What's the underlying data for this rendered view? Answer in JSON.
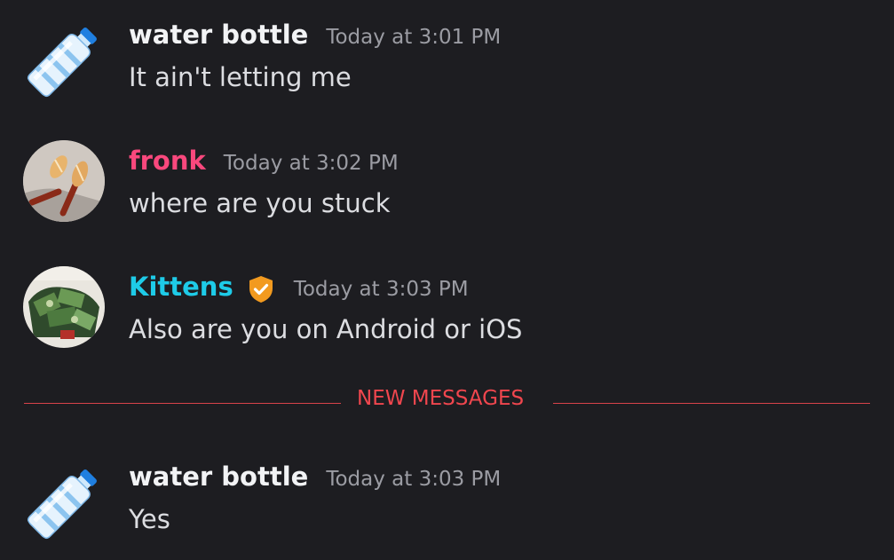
{
  "messages": [
    {
      "author": "water bottle",
      "author_color": "#f2f3f5",
      "avatar_icon": "water-bottle-emoji-icon",
      "timestamp": "Today at 3:01 PM",
      "text": "It ain't letting me"
    },
    {
      "author": "fronk",
      "author_color": "#f9487d",
      "avatar_icon": "fronk-avatar-photo",
      "timestamp": "Today at 3:02 PM",
      "text": "where are you stuck"
    },
    {
      "author": "Kittens",
      "author_color": "#1ecbe8",
      "avatar_icon": "kittens-avatar-photo",
      "badge_icon": "orange-verified-shield-icon",
      "timestamp": "Today at 3:03 PM",
      "text": "Also are you on Android or iOS"
    },
    {
      "author": "water bottle",
      "author_color": "#f2f3f5",
      "avatar_icon": "water-bottle-emoji-icon",
      "timestamp": "Today at 3:03 PM",
      "text": "Yes"
    }
  ],
  "divider": {
    "label": "NEW MESSAGES",
    "color": "#f0464e"
  }
}
